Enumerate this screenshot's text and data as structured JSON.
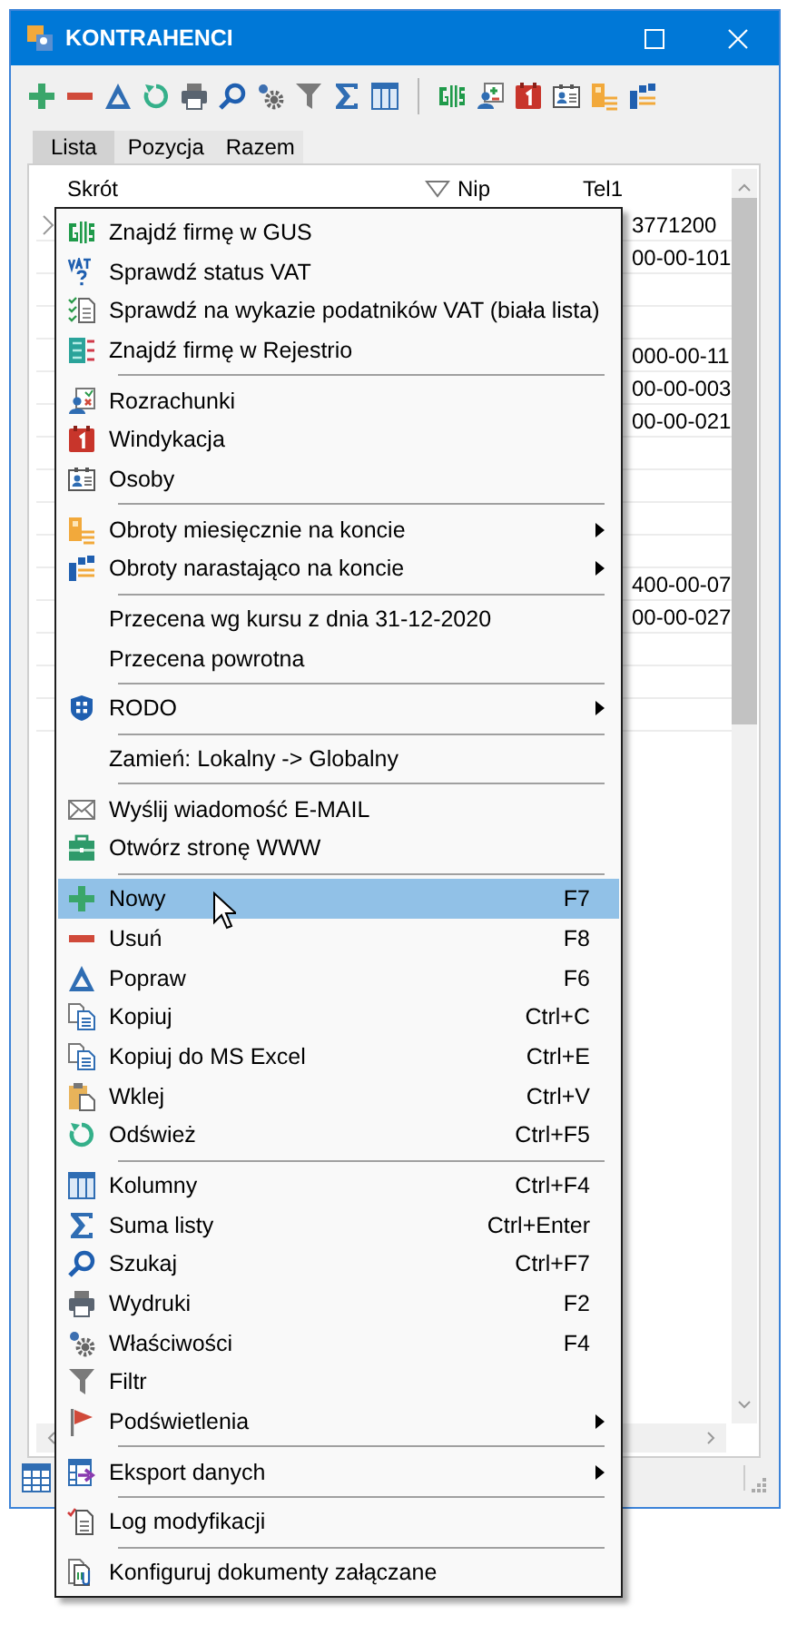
{
  "window": {
    "title": "KONTRAHENCI"
  },
  "tabs": [
    {
      "label": "Lista",
      "selected": true
    },
    {
      "label": "Pozycja",
      "selected": false
    },
    {
      "label": "Razem",
      "selected": false
    }
  ],
  "table": {
    "columns": [
      "Skrót",
      "Nip",
      "Tel1"
    ],
    "rows": [
      {
        "tel1": "3771200",
        "selected": true
      },
      {
        "tel1": "00-00-101",
        "selected": false
      },
      {
        "selected": false
      },
      {
        "selected": false
      },
      {
        "tel1": "000-00-11",
        "selected": false
      },
      {
        "tel1": "00-00-003",
        "selected": false
      },
      {
        "tel1": "00-00-021",
        "selected": false
      },
      {
        "selected": false
      },
      {
        "selected": false
      },
      {
        "selected": false
      },
      {
        "selected": false
      },
      {
        "tel1": "400-00-07",
        "selected": false
      },
      {
        "tel1": "00-00-027",
        "selected": false
      },
      {
        "selected": false
      },
      {
        "selected": false
      },
      {
        "selected": false
      }
    ]
  },
  "context_menu": {
    "items": [
      {
        "kind": "item",
        "label": "Znajdź firmę w GUS",
        "selected": false,
        "submenu": false
      },
      {
        "kind": "item",
        "label": "Sprawdź status VAT",
        "selected": false,
        "submenu": false
      },
      {
        "kind": "item",
        "label": "Sprawdź na wykazie podatników VAT (biała lista)",
        "selected": false,
        "submenu": false
      },
      {
        "kind": "item",
        "label": "Znajdź firmę w Rejestrio",
        "selected": false,
        "submenu": false
      },
      {
        "kind": "separator"
      },
      {
        "kind": "item",
        "label": "Rozrachunki",
        "selected": false,
        "submenu": false
      },
      {
        "kind": "item",
        "label": "Windykacja",
        "selected": false,
        "submenu": false
      },
      {
        "kind": "item",
        "label": "Osoby",
        "selected": false,
        "submenu": false
      },
      {
        "kind": "separator"
      },
      {
        "kind": "item",
        "label": "Obroty miesięcznie na koncie",
        "selected": false,
        "submenu": true
      },
      {
        "kind": "item",
        "label": "Obroty narastająco na koncie",
        "selected": false,
        "submenu": true
      },
      {
        "kind": "separator"
      },
      {
        "kind": "item",
        "label": "Przecena wg kursu z dnia 31-12-2020",
        "selected": false,
        "submenu": false
      },
      {
        "kind": "item",
        "label": "Przecena powrotna",
        "selected": false,
        "submenu": false
      },
      {
        "kind": "separator"
      },
      {
        "kind": "item",
        "label": "RODO",
        "selected": false,
        "submenu": true
      },
      {
        "kind": "separator"
      },
      {
        "kind": "item",
        "label": "Zamień: Lokalny -> Globalny",
        "selected": false,
        "submenu": false
      },
      {
        "kind": "separator"
      },
      {
        "kind": "item",
        "label": "Wyślij wiadomość E-MAIL",
        "selected": false,
        "submenu": false
      },
      {
        "kind": "item",
        "label": "Otwórz stronę WWW",
        "selected": false,
        "submenu": false
      },
      {
        "kind": "separator"
      },
      {
        "kind": "item",
        "label": "Nowy",
        "shortcut": "F7",
        "selected": true,
        "submenu": false
      },
      {
        "kind": "item",
        "label": "Usuń",
        "shortcut": "F8",
        "selected": false,
        "submenu": false
      },
      {
        "kind": "item",
        "label": "Popraw",
        "shortcut": "F6",
        "selected": false,
        "submenu": false
      },
      {
        "kind": "item",
        "label": "Kopiuj",
        "shortcut": "Ctrl+C",
        "selected": false,
        "submenu": false
      },
      {
        "kind": "item",
        "label": "Kopiuj do MS Excel",
        "shortcut": "Ctrl+E",
        "selected": false,
        "submenu": false
      },
      {
        "kind": "item",
        "label": "Wklej",
        "shortcut": "Ctrl+V",
        "selected": false,
        "submenu": false
      },
      {
        "kind": "item",
        "label": "Odśwież",
        "shortcut": "Ctrl+F5",
        "selected": false,
        "submenu": false
      },
      {
        "kind": "separator"
      },
      {
        "kind": "item",
        "label": "Kolumny",
        "shortcut": "Ctrl+F4",
        "selected": false,
        "submenu": false
      },
      {
        "kind": "item",
        "label": "Suma listy",
        "shortcut": "Ctrl+Enter",
        "selected": false,
        "submenu": false
      },
      {
        "kind": "item",
        "label": "Szukaj",
        "shortcut": "Ctrl+F7",
        "selected": false,
        "submenu": false
      },
      {
        "kind": "item",
        "label": "Wydruki",
        "shortcut": "F2",
        "selected": false,
        "submenu": false
      },
      {
        "kind": "item",
        "label": "Właściwości",
        "shortcut": "F4",
        "selected": false,
        "submenu": false
      },
      {
        "kind": "item",
        "label": "Filtr",
        "selected": false,
        "submenu": false
      },
      {
        "kind": "item",
        "label": "Podświetlenia",
        "selected": false,
        "submenu": true
      },
      {
        "kind": "separator"
      },
      {
        "kind": "item",
        "label": "Eksport danych",
        "selected": false,
        "submenu": true
      },
      {
        "kind": "separator"
      },
      {
        "kind": "item",
        "label": "Log modyfikacji",
        "selected": false,
        "submenu": false
      },
      {
        "kind": "separator"
      },
      {
        "kind": "item",
        "label": "Konfiguruj dokumenty załączane",
        "selected": false,
        "submenu": false
      }
    ]
  }
}
